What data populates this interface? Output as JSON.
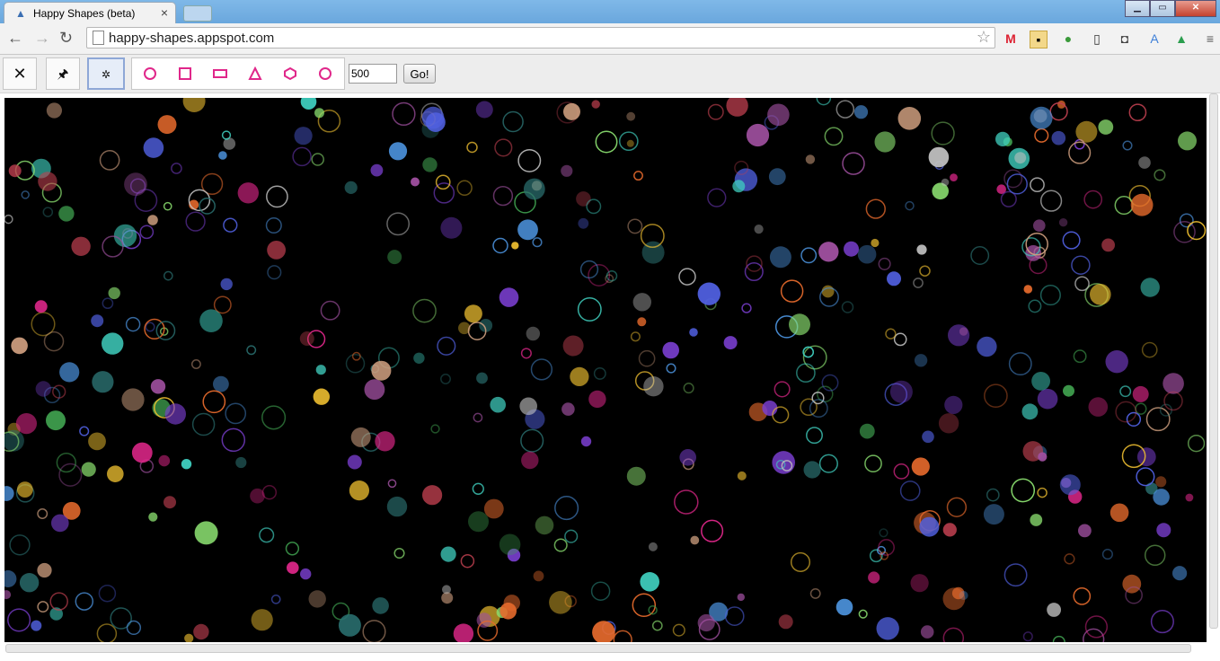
{
  "browser": {
    "tab_title": "Happy Shapes (beta)",
    "tab_close": "×",
    "url": "happy-shapes.appspot.com",
    "window_controls": {
      "minimize": "▁",
      "maximize": "▭",
      "close": "✕"
    }
  },
  "toolbar": {
    "clear_label": "✕",
    "pin_label": "🖈",
    "spinner_label": "✲",
    "shapes": [
      "circle",
      "square",
      "rectangle",
      "triangle",
      "hexagon",
      "ring"
    ],
    "shape_color": "#e0278a",
    "count_value": "500",
    "go_label": "Go!"
  },
  "canvas": {
    "background": "#000000",
    "shape_count": 500,
    "palette": [
      "#e0278a",
      "#7b3fd1",
      "#3fa04f",
      "#4a8fd8",
      "#e66a2c",
      "#f0c030",
      "#40d0c0",
      "#c0c0c0",
      "#c04050",
      "#8be070",
      "#5060e0",
      "#a050a0",
      "#d0a080",
      "#2a6f6f"
    ]
  }
}
